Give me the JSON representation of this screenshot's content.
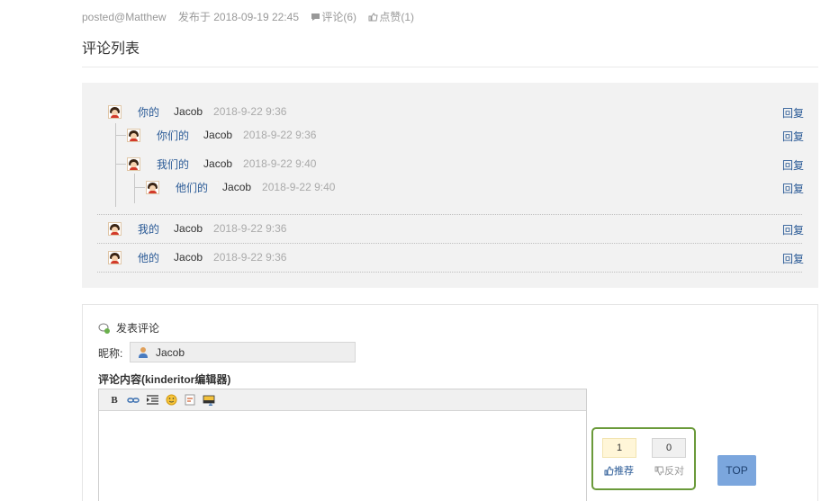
{
  "meta": {
    "posted": "posted@Matthew",
    "published": "发布于 2018-09-19 22:45",
    "comments": "评论(6)",
    "likes": "点赞(1)"
  },
  "comments_section": {
    "title": "评论列表",
    "reply_label": "回复",
    "comments": [
      {
        "text": "你的",
        "user": "Jacob",
        "time": "2018-9-22 9:36",
        "depth": 0
      },
      {
        "text": "你们的",
        "user": "Jacob",
        "time": "2018-9-22 9:36",
        "depth": 1
      },
      {
        "text": "我们的",
        "user": "Jacob",
        "time": "2018-9-22 9:40",
        "depth": 1
      },
      {
        "text": "他们的",
        "user": "Jacob",
        "time": "2018-9-22 9:40",
        "depth": 2
      },
      {
        "text": "我的",
        "user": "Jacob",
        "time": "2018-9-22 9:36",
        "depth": 0
      },
      {
        "text": "他的",
        "user": "Jacob",
        "time": "2018-9-22 9:36",
        "depth": 0
      }
    ]
  },
  "post_form": {
    "heading": "发表评论",
    "nickname_label": "昵称:",
    "nickname_value": "Jacob",
    "editor_label": "评论内容(kinderitor编辑器)",
    "toolbar": {
      "bold": "B"
    }
  },
  "vote": {
    "up_count": "1",
    "down_count": "0",
    "up_label": "推荐",
    "down_label": "反对"
  },
  "top_button": "TOP",
  "colors": {
    "link": "#2a5a96",
    "vote_border": "#6a9a3a",
    "top_button": "#7ba6dd"
  }
}
